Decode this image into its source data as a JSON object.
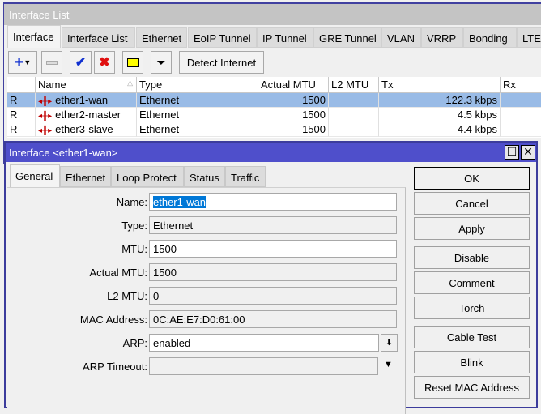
{
  "list_window": {
    "title": "Interface List",
    "tabs": [
      "Interface",
      "Interface List",
      "Ethernet",
      "EoIP Tunnel",
      "IP Tunnel",
      "GRE Tunnel",
      "VLAN",
      "VRRP",
      "Bonding",
      "LTE"
    ],
    "toolbar": {
      "add_icon": "plus-icon",
      "remove_icon": "minus-icon",
      "enable_icon": "check-icon",
      "disable_icon": "x-icon",
      "comment_icon": "note-icon",
      "filter_icon": "funnel-icon",
      "detect_internet": "Detect Internet"
    },
    "columns": [
      "",
      "Name",
      "Type",
      "Actual MTU",
      "L2 MTU",
      "Tx",
      "Rx"
    ],
    "rows": [
      {
        "flag": "R",
        "name": "ether1-wan",
        "type": "Ethernet",
        "actual_mtu": "1500",
        "l2_mtu": "",
        "tx": "122.3 kbps",
        "rx": ""
      },
      {
        "flag": "R",
        "name": "ether2-master",
        "type": "Ethernet",
        "actual_mtu": "1500",
        "l2_mtu": "",
        "tx": "4.5 kbps",
        "rx": ""
      },
      {
        "flag": "R",
        "name": "ether3-slave",
        "type": "Ethernet",
        "actual_mtu": "1500",
        "l2_mtu": "",
        "tx": "4.4 kbps",
        "rx": ""
      }
    ]
  },
  "dialog": {
    "title": "Interface <ether1-wan>",
    "tabs": [
      "General",
      "Ethernet",
      "Loop Protect",
      "Status",
      "Traffic"
    ],
    "fields": {
      "name": {
        "label": "Name:",
        "value": "ether1-wan"
      },
      "type": {
        "label": "Type:",
        "value": "Ethernet"
      },
      "mtu": {
        "label": "MTU:",
        "value": "1500"
      },
      "actual_mtu": {
        "label": "Actual MTU:",
        "value": "1500"
      },
      "l2_mtu": {
        "label": "L2 MTU:",
        "value": "0"
      },
      "mac": {
        "label": "MAC Address:",
        "value": "0C:AE:E7:D0:61:00"
      },
      "arp": {
        "label": "ARP:",
        "value": "enabled"
      },
      "arp_timeout": {
        "label": "ARP Timeout:",
        "value": ""
      }
    },
    "buttons": [
      "OK",
      "Cancel",
      "Apply",
      "Disable",
      "Comment",
      "Torch",
      "Cable Test",
      "Blink",
      "Reset MAC Address"
    ]
  },
  "colors": {
    "dialog_title": "#4f4fcb",
    "selection": "#99bbe6",
    "text_selection": "#0078d7"
  }
}
